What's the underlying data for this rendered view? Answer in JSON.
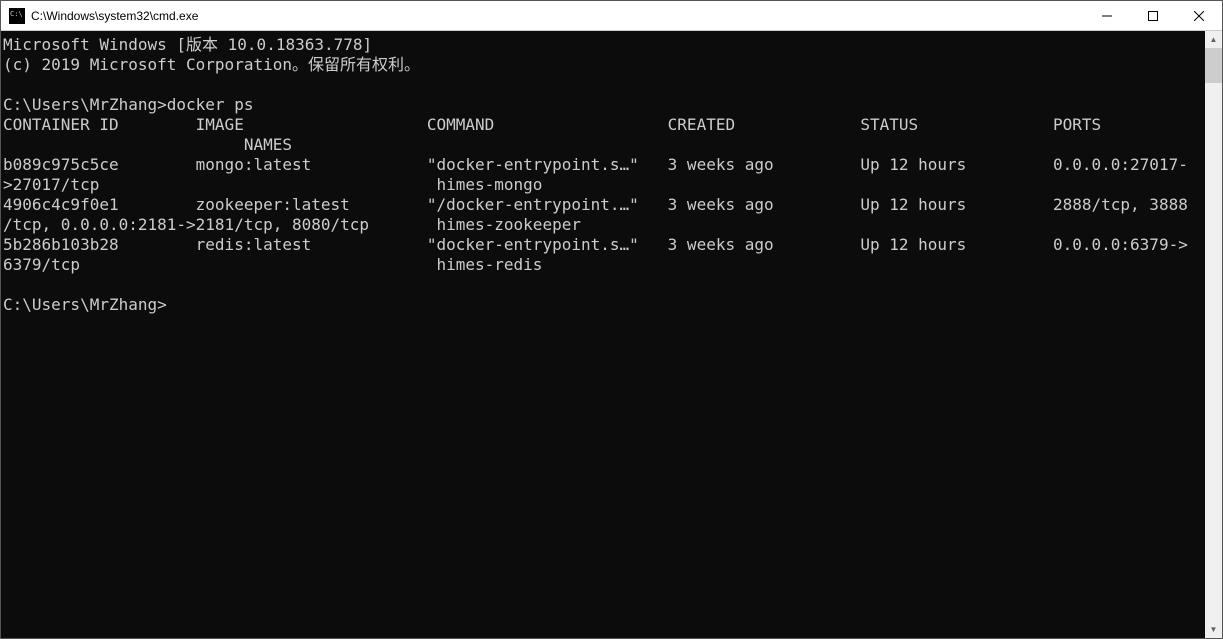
{
  "window": {
    "title": "C:\\Windows\\system32\\cmd.exe"
  },
  "terminal": {
    "lines": [
      "Microsoft Windows [版本 10.0.18363.778]",
      "(c) 2019 Microsoft Corporation。保留所有权利。",
      "",
      "C:\\Users\\MrZhang>docker ps",
      "CONTAINER ID        IMAGE                   COMMAND                  CREATED             STATUS              PORTS",
      "                         NAMES",
      "b089c975c5ce        mongo:latest            \"docker-entrypoint.s…\"   3 weeks ago         Up 12 hours         0.0.0.0:27017-",
      ">27017/tcp                                   himes-mongo",
      "4906c4c9f0e1        zookeeper:latest        \"/docker-entrypoint.…\"   3 weeks ago         Up 12 hours         2888/tcp, 3888",
      "/tcp, 0.0.0.0:2181->2181/tcp, 8080/tcp       himes-zookeeper",
      "5b286b103b28        redis:latest            \"docker-entrypoint.s…\"   3 weeks ago         Up 12 hours         0.0.0.0:6379->",
      "6379/tcp                                     himes-redis",
      "",
      "C:\\Users\\MrZhang>"
    ]
  },
  "docker_ps": {
    "command": "docker ps",
    "prompt": "C:\\Users\\MrZhang>",
    "headers": [
      "CONTAINER ID",
      "IMAGE",
      "COMMAND",
      "CREATED",
      "STATUS",
      "PORTS",
      "NAMES"
    ],
    "rows": [
      {
        "container_id": "b089c975c5ce",
        "image": "mongo:latest",
        "command": "\"docker-entrypoint.s…\"",
        "created": "3 weeks ago",
        "status": "Up 12 hours",
        "ports": "0.0.0.0:27017->27017/tcp",
        "names": "himes-mongo"
      },
      {
        "container_id": "4906c4c9f0e1",
        "image": "zookeeper:latest",
        "command": "\"/docker-entrypoint.…\"",
        "created": "3 weeks ago",
        "status": "Up 12 hours",
        "ports": "2888/tcp, 3888/tcp, 0.0.0.0:2181->2181/tcp, 8080/tcp",
        "names": "himes-zookeeper"
      },
      {
        "container_id": "5b286b103b28",
        "image": "redis:latest",
        "command": "\"docker-entrypoint.s…\"",
        "created": "3 weeks ago",
        "status": "Up 12 hours",
        "ports": "0.0.0.0:6379->6379/tcp",
        "names": "himes-redis"
      }
    ]
  }
}
